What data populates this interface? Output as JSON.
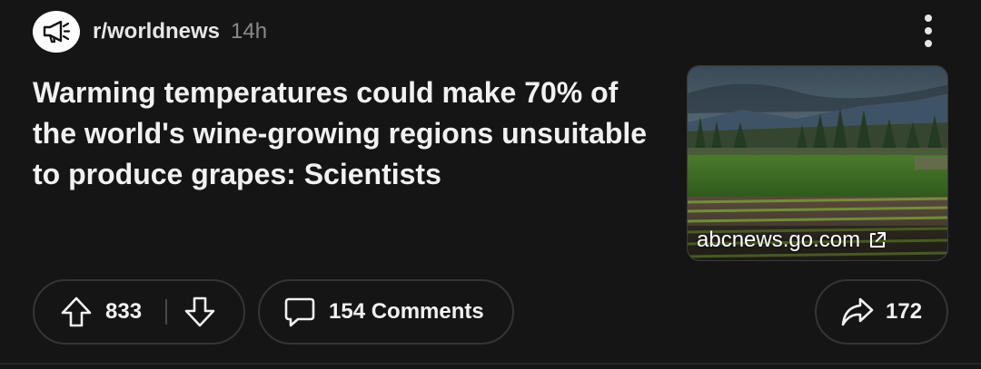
{
  "post": {
    "subreddit": "r/worldnews",
    "age": "14h",
    "subreddit_icon": "megaphone-icon",
    "title": "Warming temperatures could make 70% of the world's wine-growing regions unsuitable to produce grapes: Scientists",
    "link": {
      "domain": "abcnews.go.com",
      "icon": "external-link-icon"
    },
    "actions": {
      "upvote_icon": "arrow-up-icon",
      "score": "833",
      "downvote_icon": "arrow-down-icon",
      "comments_label": "154 Comments",
      "comments_icon": "comment-bubble-icon",
      "share_icon": "share-arrow-icon",
      "share_count": "172"
    },
    "more_icon": "kebab-menu-icon"
  },
  "colors": {
    "background": "#151515",
    "text": "#f1f1f1",
    "muted": "#8a8a8a",
    "pill_border": "#353535"
  }
}
